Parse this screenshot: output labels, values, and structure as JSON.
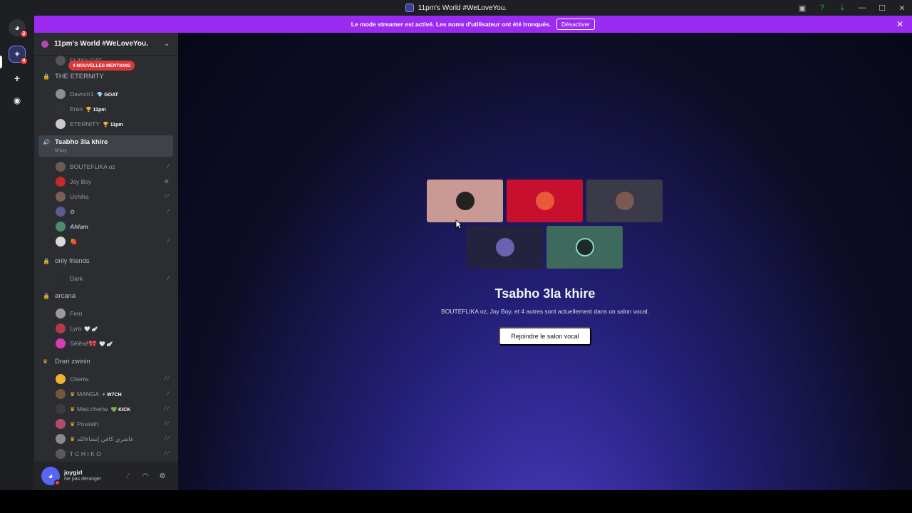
{
  "window": {
    "title": "11pm's World #WeLoveYou."
  },
  "rail": {
    "home_badge": "2",
    "server_badge": "4"
  },
  "banner": {
    "text": "Le mode streamer est activé. Les noms d'utilisateur ont été tronqués.",
    "button": "Désactiver"
  },
  "server": {
    "name": "11pm's World #WeLoveYou.",
    "mentions": "4 NOUVELLES MENTIONS"
  },
  "channels": {
    "partial_top": "FL3X's CAT",
    "eternity": {
      "name": "THE ETERNITY",
      "members": [
        {
          "name": "Davnch1",
          "tag": "💎 GOAT"
        },
        {
          "name": "Eren",
          "tag": "🏆 11pm"
        },
        {
          "name": "ETERNITY",
          "tag": "🏆 11pm"
        }
      ]
    },
    "active": {
      "name": "Tsabho 3la khire",
      "sub": "M'psy",
      "members": [
        {
          "name": "BOUTEFLIKA oz"
        },
        {
          "name": "Joy Boy"
        },
        {
          "name": "Uchiha"
        },
        {
          "name": "✿"
        },
        {
          "name": "Ahlam"
        },
        {
          "name": "🍓"
        }
      ]
    },
    "only_friends": {
      "name": "only friends",
      "members": [
        {
          "name": "Dark"
        }
      ]
    },
    "arcana": {
      "name": "arcana",
      "members": [
        {
          "name": "Fern",
          "tag": ""
        },
        {
          "name": "Lyra",
          "tag": "🤍 🪽"
        },
        {
          "name": "Sêlênê🎀",
          "tag": "🤍 🪽"
        }
      ]
    },
    "drari": {
      "name": "Drari zwinin",
      "members": [
        {
          "name": "Cheriw",
          "tag": ""
        },
        {
          "name": "MANGA",
          "tag": "⚡ W7CH"
        },
        {
          "name": "Med.cheriw",
          "tag": "💚 KICK"
        },
        {
          "name": "Poussin",
          "tag": ""
        },
        {
          "name": "عاشري كافي إنشاءالله",
          "tag": ""
        },
        {
          "name": "T C H I K O",
          "tag": ""
        }
      ]
    }
  },
  "user": {
    "name": "joygirl",
    "status": "Ne pas déranger"
  },
  "main": {
    "title": "Tsabho 3la khire",
    "description": "BOUTEFLIKA oz, Joy Boy, et 4 autres sont actuellement dans un salon vocal.",
    "join_button": "Rejoindre le salon vocal"
  }
}
